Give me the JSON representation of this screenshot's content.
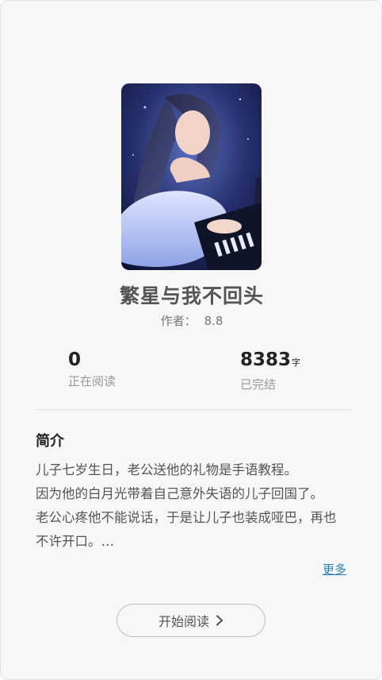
{
  "book": {
    "title": "繁星与我不回头",
    "author_label": "作者：",
    "score": "8.8",
    "cover_icon": "book-cover-image"
  },
  "stats": {
    "reading_count": "0",
    "reading_label": "正在阅读",
    "word_count": "8383",
    "word_unit": "字",
    "status_label": "已完结"
  },
  "intro": {
    "heading": "简介",
    "lines": [
      "儿子七岁生日，老公送他的礼物是手语教程。",
      "因为他的白月光带着自己意外失语的儿子回国了。",
      "老公心疼他不能说话，于是让儿子也装成哑巴，再也不许开口。…"
    ],
    "more_label": "更多"
  },
  "actions": {
    "start_label": "开始阅读",
    "start_icon": "chevron-right-icon"
  },
  "colors": {
    "link": "#2a7fc0",
    "title": "#555555"
  }
}
